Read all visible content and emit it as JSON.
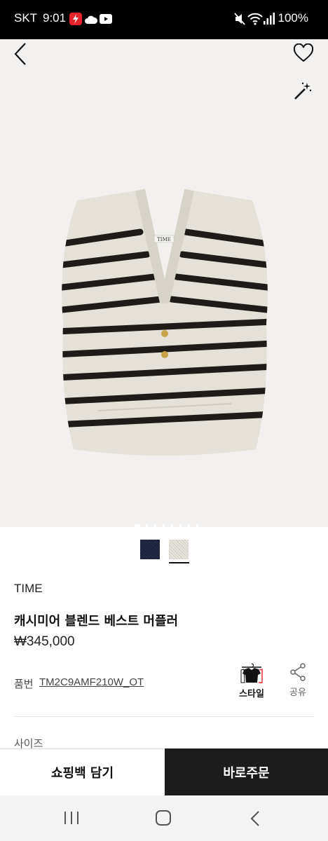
{
  "status_bar": {
    "carrier": "SKT",
    "time": "9:01",
    "battery": "100%",
    "icons": [
      "flash-app-icon",
      "cloud-icon",
      "youtube-icon",
      "mute-icon",
      "wifi-icon",
      "signal-icon"
    ]
  },
  "header": {
    "icons": [
      "back-icon",
      "heart-icon",
      "magic-wand-icon"
    ]
  },
  "gallery": {
    "image": "striped-knit-vest",
    "total_images": 8,
    "current_index": 1
  },
  "colors": {
    "swatches": [
      {
        "name": "navy",
        "hex": "#1a1f3a",
        "selected": false
      },
      {
        "name": "beige",
        "hex": "#e4e1da",
        "selected": true
      }
    ],
    "buy_button": "#1c1c1c"
  },
  "product": {
    "brand": "TIME",
    "name": "캐시미어 블렌드 베스트 머플러",
    "price": "₩345,000",
    "sku_label": "품번",
    "sku_value": "TM2C9AMF210W_OT"
  },
  "actions": {
    "style_label": "스타일",
    "share_label": "공유"
  },
  "options": {
    "size_label": "사이즈"
  },
  "bottom": {
    "cart_label": "쇼핑백 담기",
    "buy_label": "바로주문"
  },
  "nav_bar": {
    "icons": [
      "recent-apps-icon",
      "home-icon",
      "back-nav-icon"
    ]
  }
}
